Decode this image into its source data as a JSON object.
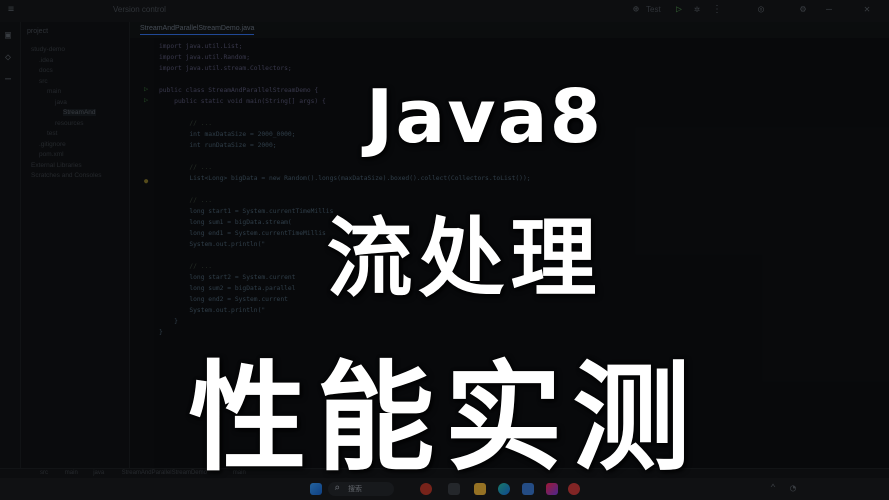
{
  "ide": {
    "title_items": [
      "",
      "",
      "Version control"
    ],
    "run_config": "Test",
    "project_label": "project",
    "tab_file": "StreamAndParallelStreamDemo.java",
    "tree": [
      {
        "label": "study-demo",
        "selected": false
      },
      {
        "label": ".idea",
        "selected": false
      },
      {
        "label": "docs",
        "selected": false
      },
      {
        "label": "src",
        "selected": false
      },
      {
        "label": "main",
        "selected": false
      },
      {
        "label": "java",
        "selected": false
      },
      {
        "label": "StreamAnd",
        "selected": true
      },
      {
        "label": "resources",
        "selected": false
      },
      {
        "label": "test",
        "selected": false
      },
      {
        "label": ".gitignore",
        "selected": false
      },
      {
        "label": "pom.xml",
        "selected": false
      },
      {
        "label": "External Libraries",
        "selected": false
      },
      {
        "label": "Scratches and Consoles",
        "selected": false
      }
    ],
    "code_lines": [
      {
        "text": "import java.util.List;",
        "style": "k"
      },
      {
        "text": "import java.util.Random;",
        "style": "k"
      },
      {
        "text": "import java.util.stream.Collectors;",
        "style": "k"
      },
      {
        "text": "",
        "style": ""
      },
      {
        "text": "public class StreamAndParallelStreamDemo {",
        "style": "k"
      },
      {
        "text": "    public static void main(String[] args) {",
        "style": "k"
      },
      {
        "text": "",
        "style": ""
      },
      {
        "text": "        // ...",
        "style": "c"
      },
      {
        "text": "        int maxDataSize = 2000_0000;",
        "style": ""
      },
      {
        "text": "        int runDataSize = 2000;",
        "style": ""
      },
      {
        "text": "",
        "style": ""
      },
      {
        "text": "        // ...",
        "style": "c"
      },
      {
        "text": "        List<Long> bigData = new Random().longs(maxDataSize).boxed().collect(Collectors.toList());",
        "style": ""
      },
      {
        "text": "",
        "style": ""
      },
      {
        "text": "        // ...",
        "style": "c"
      },
      {
        "text": "        long start1 = System.currentTimeMillis",
        "style": ""
      },
      {
        "text": "        long sum1 = bigData.stream(",
        "style": ""
      },
      {
        "text": "        long end1 = System.currentTimeMillis",
        "style": ""
      },
      {
        "text": "        System.out.println(\"",
        "style": ""
      },
      {
        "text": "",
        "style": ""
      },
      {
        "text": "        // ...",
        "style": "c"
      },
      {
        "text": "        long start2 = System.current",
        "style": ""
      },
      {
        "text": "        long sum2 = bigData.parallel",
        "style": ""
      },
      {
        "text": "        long end2 = System.current",
        "style": ""
      },
      {
        "text": "        System.out.println(\"",
        "style": ""
      },
      {
        "text": "    }",
        "style": ""
      },
      {
        "text": "}",
        "style": ""
      }
    ],
    "status_path": [
      "src",
      "main",
      "java",
      "StreamAndParallelStreamDemo",
      "main"
    ],
    "status_right": [
      "",
      "",
      ""
    ]
  },
  "taskbar": {
    "search_label": "搜索",
    "time": ""
  },
  "overlay": {
    "line1": "Java8",
    "line2": "流处理",
    "line3": "性能实测"
  },
  "colors": {
    "background": "#0b0c0e",
    "headline": "#ffffff",
    "accent": "#3574f0"
  }
}
